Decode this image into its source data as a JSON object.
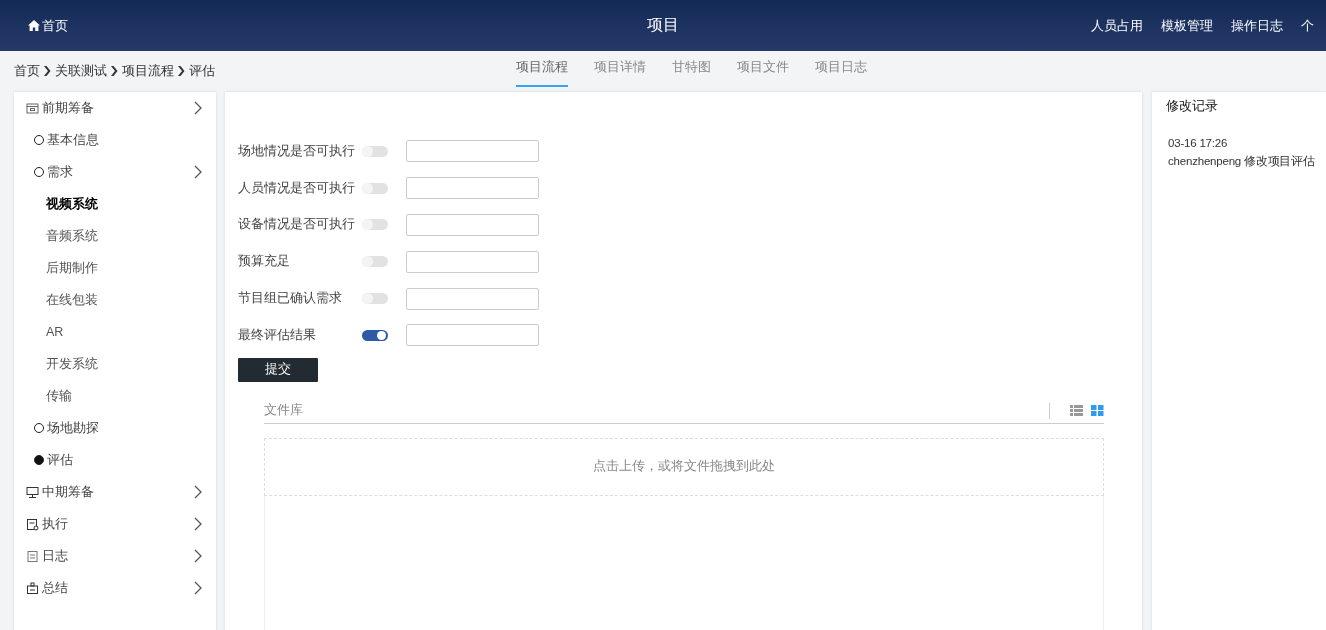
{
  "header": {
    "home_link": "首页",
    "title": "项目",
    "nav_links": [
      "人员占用",
      "模板管理",
      "操作日志",
      "个"
    ]
  },
  "breadcrumb": [
    "首页",
    "关联测试",
    "项目流程",
    "评估"
  ],
  "tabs": [
    {
      "label": "项目流程",
      "selected": true
    },
    {
      "label": "项目详情",
      "selected": false
    },
    {
      "label": "甘特图",
      "selected": false
    },
    {
      "label": "项目文件",
      "selected": false
    },
    {
      "label": "项目日志",
      "selected": false
    }
  ],
  "sidebar": {
    "items": [
      {
        "label": "前期筹备",
        "kind": "stage",
        "expandable": true,
        "children": [
          {
            "label": "基本信息",
            "kind": "step",
            "selected": false,
            "expandable": false
          },
          {
            "label": "需求",
            "kind": "step",
            "selected": false,
            "expandable": true,
            "children": [
              {
                "label": "视频系统",
                "kind": "sub",
                "selected": true
              },
              {
                "label": "音频系统",
                "kind": "sub",
                "selected": false
              },
              {
                "label": "后期制作",
                "kind": "sub",
                "selected": false
              },
              {
                "label": "在线包装",
                "kind": "sub",
                "selected": false
              },
              {
                "label": "AR",
                "kind": "sub",
                "selected": false
              },
              {
                "label": "开发系统",
                "kind": "sub",
                "selected": false
              },
              {
                "label": "传输",
                "kind": "sub",
                "selected": false
              }
            ]
          },
          {
            "label": "场地勘探",
            "kind": "step",
            "selected": false,
            "expandable": false
          },
          {
            "label": "评估",
            "kind": "step",
            "selected": true,
            "expandable": false
          }
        ]
      },
      {
        "label": "中期筹备",
        "kind": "stage",
        "expandable": true
      },
      {
        "label": "执行",
        "kind": "stage",
        "expandable": true
      },
      {
        "label": "日志",
        "kind": "stage",
        "expandable": true
      },
      {
        "label": "总结",
        "kind": "stage",
        "expandable": true
      }
    ]
  },
  "form": {
    "fields": [
      {
        "label": "场地情况是否可执行",
        "on": false
      },
      {
        "label": "人员情况是否可执行",
        "on": false
      },
      {
        "label": "设备情况是否可执行",
        "on": false
      },
      {
        "label": "预算充足",
        "on": false
      },
      {
        "label": "节目组已确认需求",
        "on": false
      },
      {
        "label": "最终评估结果",
        "on": true
      }
    ],
    "submit": "提交"
  },
  "file_library": {
    "title": "文件库",
    "views": [
      {
        "kind": "list",
        "selected": false
      },
      {
        "kind": "grid",
        "selected": true
      }
    ],
    "dropzone": "点击上传，或将文件拖拽到此处"
  },
  "change_log": {
    "title": "修改记录",
    "entries": [
      {
        "time": "03-16 17:26",
        "text": "chenzhenpeng 修改项目评估"
      }
    ]
  }
}
